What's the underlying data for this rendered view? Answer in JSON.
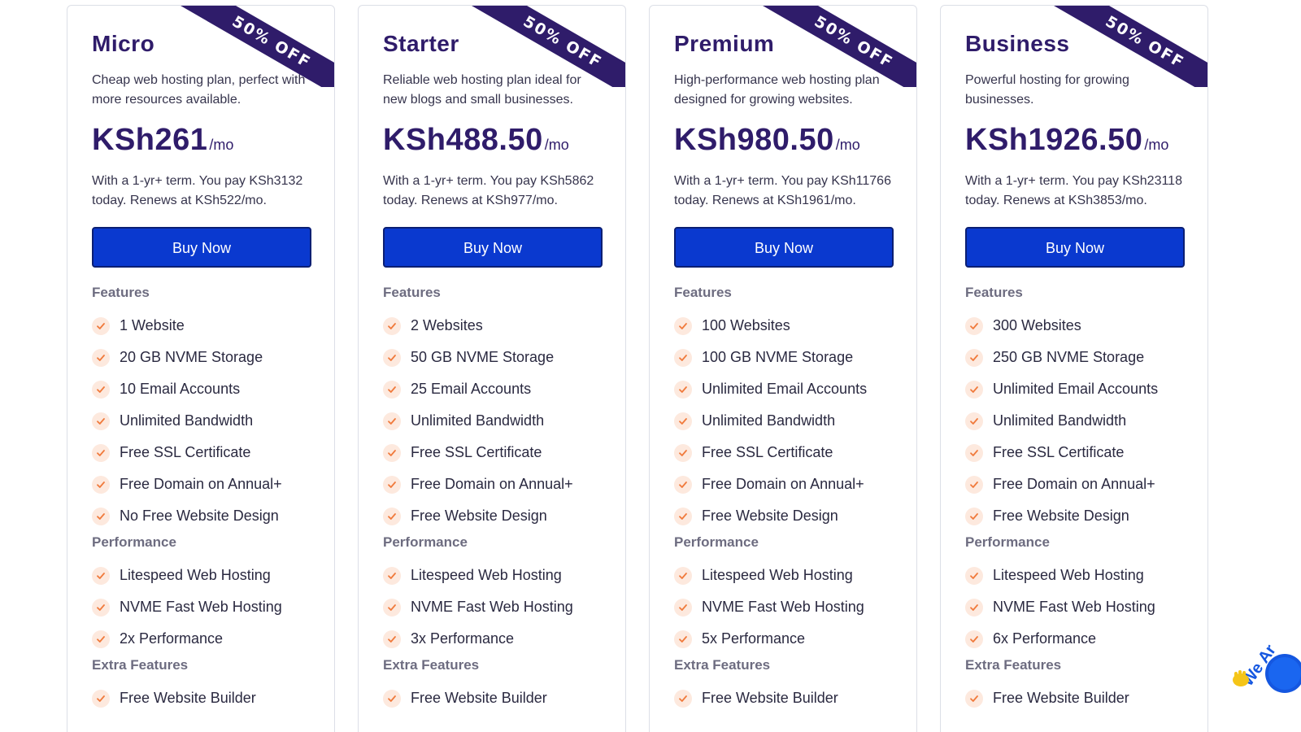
{
  "ribbon_text": "50% OFF",
  "accent": "#0a39cf",
  "brand": "#2f1c6a",
  "check_color": "#f07a3c",
  "plans": [
    {
      "name": "Micro",
      "description": "Cheap web hosting plan, perfect with more resources available.",
      "price": "KSh261",
      "per": "/mo",
      "term": "With a 1-yr+ term. You pay KSh3132 today. Renews at KSh522/mo.",
      "buy_label": "Buy Now",
      "features_title": "Features",
      "features": [
        "1 Website",
        "20 GB NVME Storage",
        "10 Email Accounts",
        "Unlimited Bandwidth",
        "Free SSL Certificate",
        "Free Domain on Annual+",
        "No Free Website Design"
      ],
      "performance_title": "Performance",
      "performance": [
        "Litespeed Web Hosting",
        "NVME Fast Web Hosting",
        "2x Performance"
      ],
      "extra_title": "Extra Features",
      "extra": [
        "Free Website Builder"
      ]
    },
    {
      "name": "Starter",
      "description": "Reliable web hosting plan ideal for new blogs and small businesses.",
      "price": "KSh488.50",
      "per": "/mo",
      "term": "With a 1-yr+ term. You pay KSh5862 today. Renews at KSh977/mo.",
      "buy_label": "Buy Now",
      "features_title": "Features",
      "features": [
        "2 Websites",
        "50 GB NVME Storage",
        "25 Email Accounts",
        "Unlimited Bandwidth",
        "Free SSL Certificate",
        "Free Domain on Annual+",
        "Free Website Design"
      ],
      "performance_title": "Performance",
      "performance": [
        "Litespeed Web Hosting",
        "NVME Fast Web Hosting",
        "3x Performance"
      ],
      "extra_title": "Extra Features",
      "extra": [
        "Free Website Builder"
      ]
    },
    {
      "name": "Premium",
      "description": "High-performance web hosting plan designed for growing websites.",
      "price": "KSh980.50",
      "per": "/mo",
      "term": "With a 1-yr+ term. You pay KSh11766 today. Renews at KSh1961/mo.",
      "buy_label": "Buy Now",
      "features_title": "Features",
      "features": [
        "100 Websites",
        "100 GB NVME Storage",
        "Unlimited Email Accounts",
        "Unlimited Bandwidth",
        "Free SSL Certificate",
        "Free Domain on Annual+",
        "Free Website Design"
      ],
      "performance_title": "Performance",
      "performance": [
        "Litespeed Web Hosting",
        "NVME Fast Web Hosting",
        "5x Performance"
      ],
      "extra_title": "Extra Features",
      "extra": [
        "Free Website Builder"
      ]
    },
    {
      "name": "Business",
      "description": "Powerful hosting for growing businesses.",
      "price": "KSh1926.50",
      "per": "/mo",
      "term": "With a 1-yr+ term. You pay KSh23118 today. Renews at KSh3853/mo.",
      "buy_label": "Buy Now",
      "features_title": "Features",
      "features": [
        "300 Websites",
        "250 GB NVME Storage",
        "Unlimited Email Accounts",
        "Unlimited Bandwidth",
        "Free SSL Certificate",
        "Free Domain on Annual+",
        "Free Website Design"
      ],
      "performance_title": "Performance",
      "performance": [
        "Litespeed Web Hosting",
        "NVME Fast Web Hosting",
        "6x Performance"
      ],
      "extra_title": "Extra Features",
      "extra": [
        "Free Website Builder"
      ]
    }
  ],
  "chat_widget": {
    "icon": "waving-hand-icon",
    "label": "We Ar"
  }
}
